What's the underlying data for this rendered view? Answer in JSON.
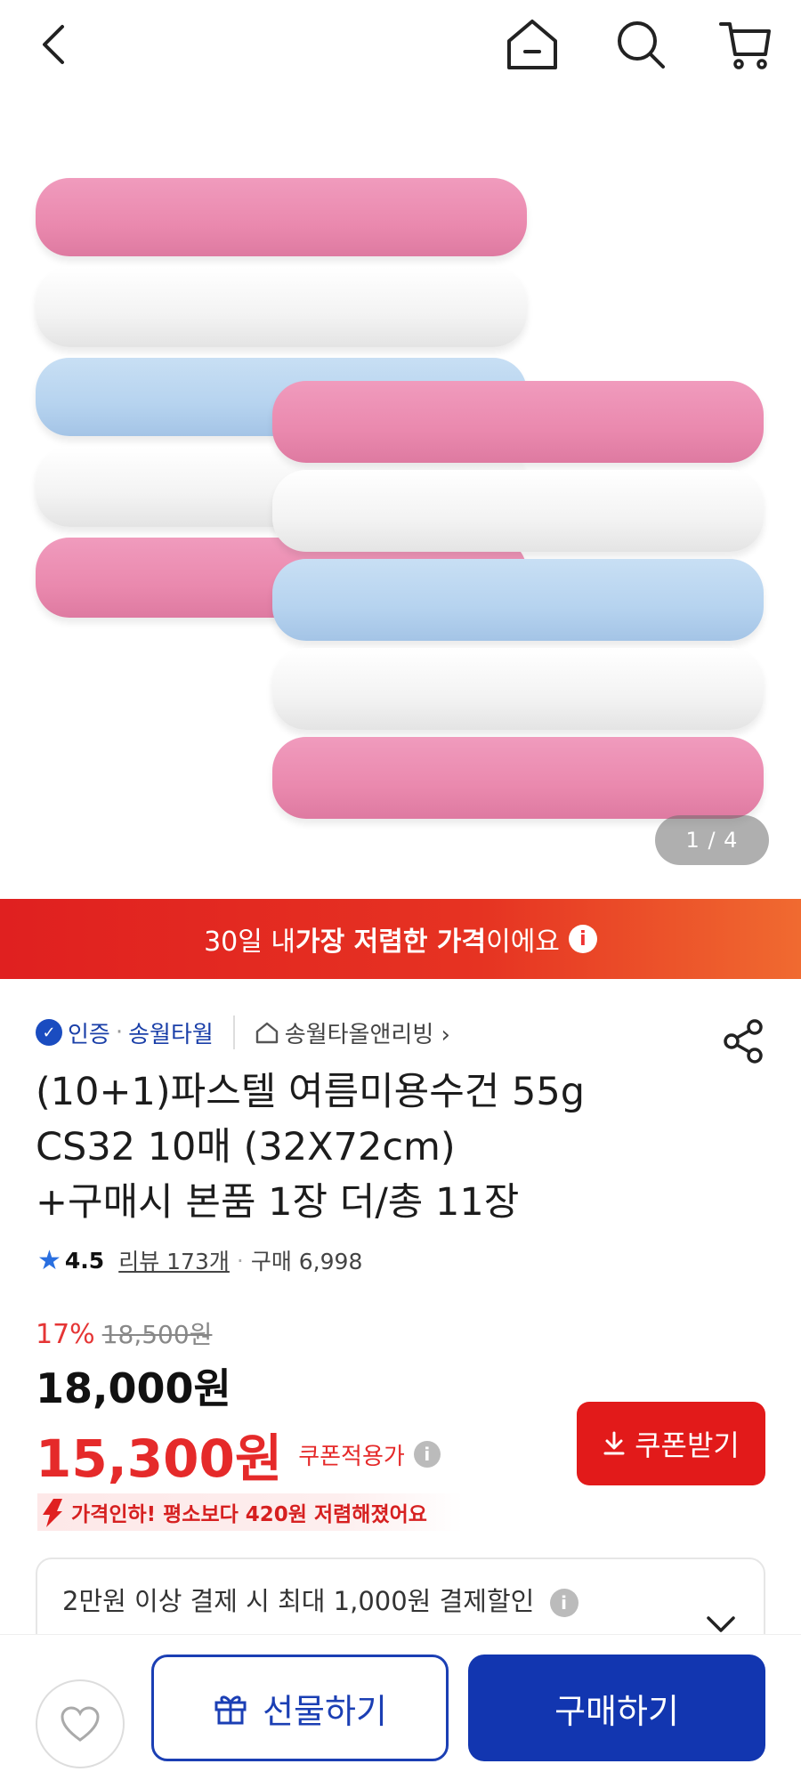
{
  "image_counter": "1 / 4",
  "banner": {
    "prefix": "30일 내 ",
    "strong": "가장 저렴한 가격",
    "suffix": "이에요",
    "info": "i"
  },
  "seller": {
    "badge": "인증",
    "sep": "·",
    "brand": "송월타월",
    "shop": "송월타올앤리빙 ›"
  },
  "product": {
    "title_line1": "(10+1)파스텔 여름미용수건 55g",
    "title_line2": "CS32 10매 (32X72cm)",
    "title_line3": "+구매시 본품 1장 더/총 11장"
  },
  "rating": {
    "star": "★",
    "score": "4.5",
    "review": "리뷰 173개",
    "dot": "·",
    "sales": "구매 6,998"
  },
  "pricing": {
    "discount_pct": "17%",
    "original_price": "18,500원",
    "price": "18,000원",
    "coupon_price": "15,300원",
    "coupon_label": "쿠폰적용가",
    "info": "i"
  },
  "coupon_button": {
    "label": "쿠폰받기"
  },
  "price_drop": {
    "text": "가격인하! 평소보다 420원 저렴해졌어요"
  },
  "payment_discount": {
    "text": "2만원 이상 결제 시 최대 1,000원 결제할인",
    "info": "i"
  },
  "bottom_bar": {
    "gift_label": "선물하기",
    "buy_label": "구매하기"
  },
  "colors": {
    "brand_blue": "#1236b0",
    "sale_red": "#e52a2a",
    "banner_red": "#e02020"
  }
}
